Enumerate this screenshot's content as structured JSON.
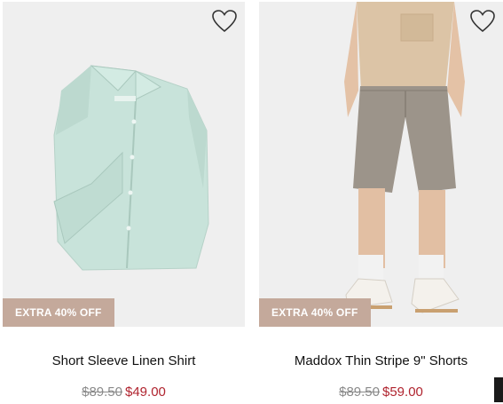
{
  "products": [
    {
      "name": "Short Sleeve Linen Shirt",
      "badge": "EXTRA 40% OFF",
      "original_price": "$89.50",
      "sale_price": "$49.00",
      "favorite_icon": "heart-outline-icon"
    },
    {
      "name": "Maddox Thin Stripe 9\" Shorts",
      "badge": "EXTRA 40% OFF",
      "original_price": "$89.50",
      "sale_price": "$59.00",
      "favorite_icon": "heart-outline-icon"
    }
  ],
  "colors": {
    "badge_bg": "#c4a99b",
    "sale_price": "#b0242f",
    "photo_bg": "#efefef"
  }
}
